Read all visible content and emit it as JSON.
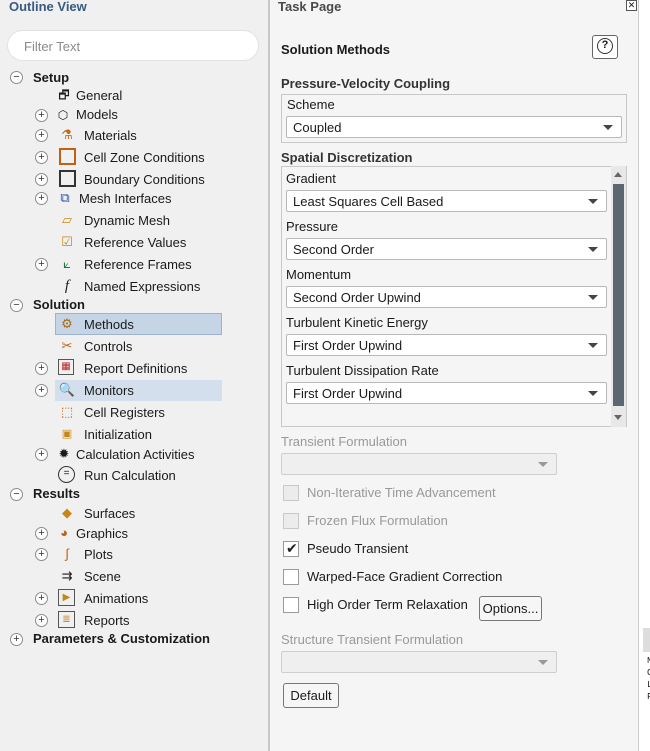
{
  "outline": {
    "title": "Outline View",
    "filter_placeholder": "Filter Text",
    "setup": "Setup",
    "general": "General",
    "models": "Models",
    "materials": "Materials",
    "cell_zone": "Cell Zone Conditions",
    "boundary": "Boundary Conditions",
    "mesh_interfaces": "Mesh Interfaces",
    "dynamic_mesh": "Dynamic Mesh",
    "reference_values": "Reference Values",
    "reference_frames": "Reference Frames",
    "named_expressions": "Named Expressions",
    "solution": "Solution",
    "methods": "Methods",
    "controls": "Controls",
    "report_definitions": "Report Definitions",
    "monitors": "Monitors",
    "cell_registers": "Cell Registers",
    "initialization": "Initialization",
    "calc_activities": "Calculation Activities",
    "run_calc": "Run Calculation",
    "results": "Results",
    "surfaces": "Surfaces",
    "graphics": "Graphics",
    "plots": "Plots",
    "scene": "Scene",
    "animations": "Animations",
    "reports": "Reports",
    "parameters": "Parameters & Customization"
  },
  "task": {
    "title": "Task Page",
    "heading": "Solution Methods",
    "pv_coupling": "Pressure-Velocity Coupling",
    "scheme_label": "Scheme",
    "scheme_value": "Coupled",
    "spatial": "Spatial Discretization",
    "gradient_label": "Gradient",
    "gradient_value": "Least Squares Cell Based",
    "pressure_label": "Pressure",
    "pressure_value": "Second Order",
    "momentum_label": "Momentum",
    "momentum_value": "Second Order Upwind",
    "tke_label": "Turbulent Kinetic Energy",
    "tke_value": "First Order Upwind",
    "tdr_label": "Turbulent Dissipation Rate",
    "tdr_value": "First Order Upwind",
    "transient_label": "Transient Formulation",
    "nita": "Non-Iterative Time Advancement",
    "frozen": "Frozen Flux Formulation",
    "pseudo": "Pseudo Transient",
    "warped": "Warped-Face Gradient Correction",
    "hotr": "High Order Term Relaxation",
    "options_btn": "Options...",
    "structure_transient": "Structure Transient Formulation",
    "default_btn": "Default",
    "pseudo_checked": true
  },
  "strip_text": [
    "N",
    "C",
    "L",
    "F"
  ]
}
